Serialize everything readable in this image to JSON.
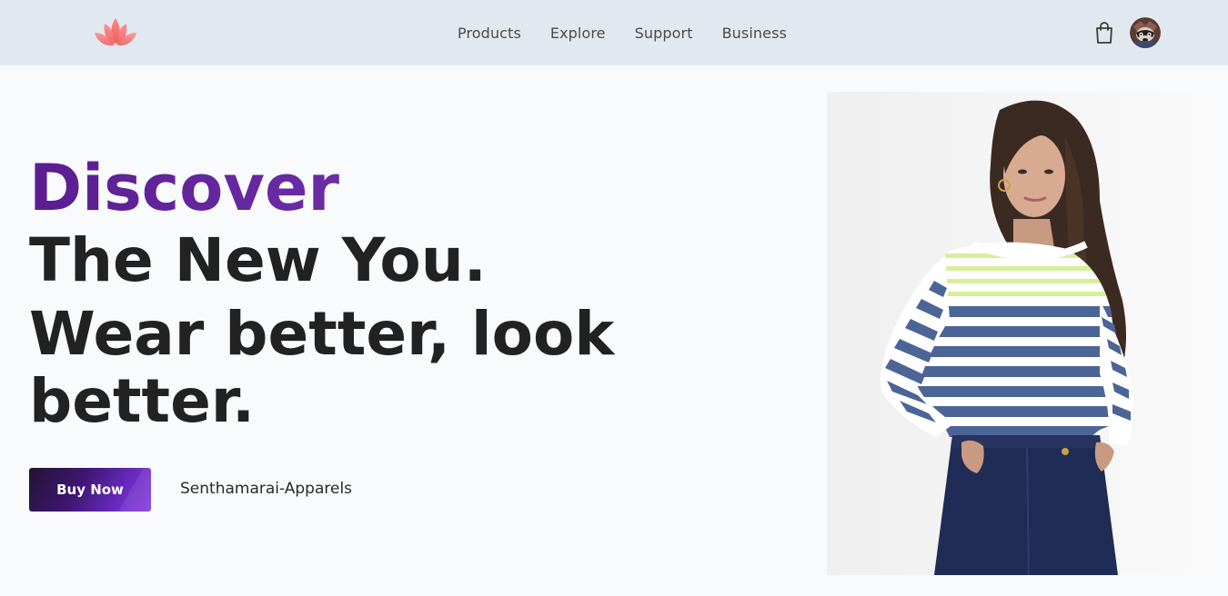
{
  "nav": {
    "logo": "lotus-logo",
    "links": [
      "Products",
      "Explore",
      "Support",
      "Business"
    ],
    "cart_icon": "shopping-bag-icon",
    "avatar": "user-avatar"
  },
  "hero": {
    "headline_accent": "Discover",
    "headline_line1": "The New You.",
    "headline_line2": "Wear better, look better.",
    "buy_button": "Buy Now",
    "brand": "Senthamarai-Apparels",
    "image": "model-in-striped-sweater"
  },
  "colors": {
    "nav_bg": "#e2e8f0",
    "page_bg": "#f8fafc",
    "accent_purple": "#6a2ba8",
    "logo_pink": "#f26b6b"
  }
}
